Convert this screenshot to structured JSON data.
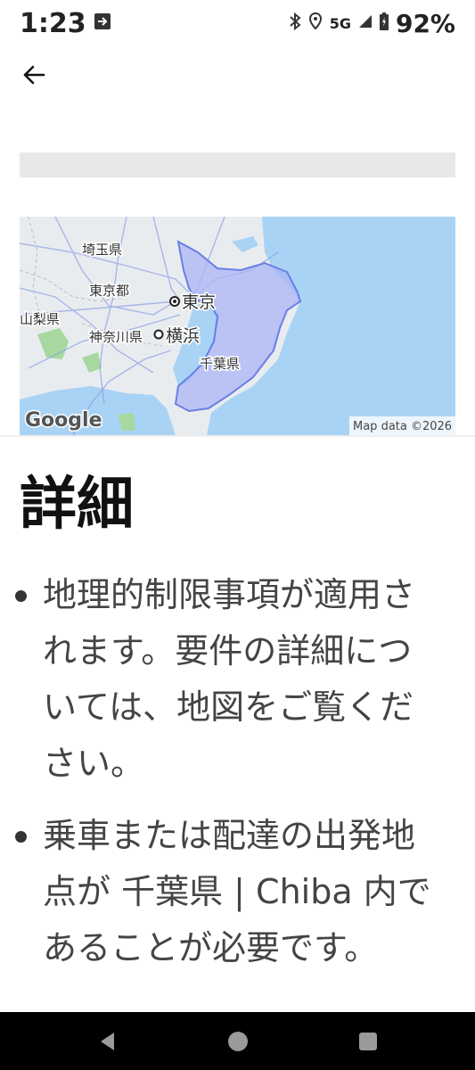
{
  "status_bar": {
    "time": "1:23",
    "network": "5G",
    "battery": "92%"
  },
  "map": {
    "labels": {
      "saitama": "埼玉県",
      "tokyo_to": "東京都",
      "tokyo": "東京",
      "yamanashi": "山梨県",
      "kanagawa": "神奈川県",
      "yokohama": "横浜",
      "chiba": "千葉県"
    },
    "logo": "Google",
    "attribution": "Map data ©2026",
    "colors": {
      "land": "#e9ecef",
      "water": "#a9d3f5",
      "region_fill": "#a9b6f4",
      "region_stroke": "#6a7ee6",
      "park": "#a7d8a0"
    }
  },
  "details": {
    "title": "詳細",
    "items": [
      "地理的制限事項が適用されます。要件の詳細については、地図をご覧ください。",
      "乗車または配達の出発地点が 千葉県 | Chiba 内であることが必要です。"
    ]
  }
}
